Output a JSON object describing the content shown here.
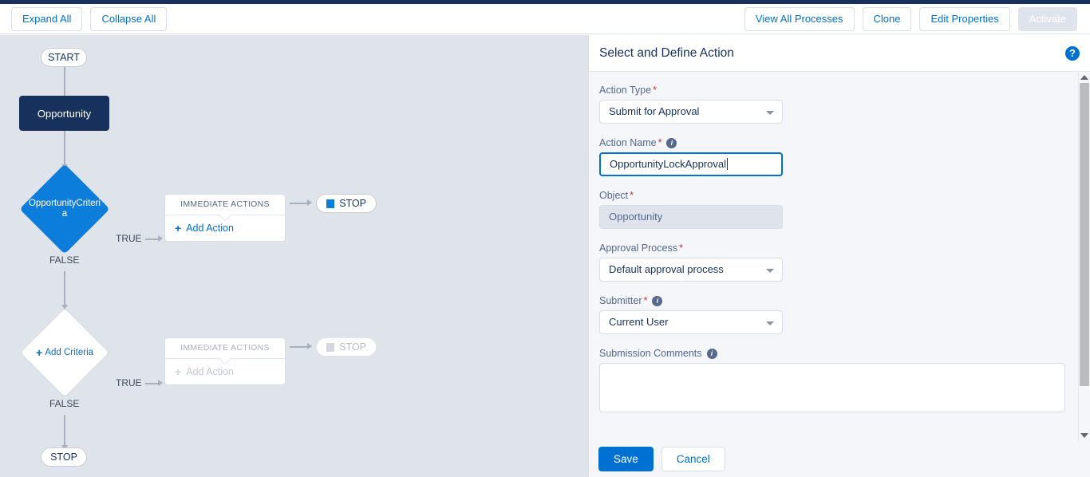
{
  "toolbar": {
    "left_buttons": [
      {
        "label": "Expand All",
        "name": "expand-all-button"
      },
      {
        "label": "Collapse All",
        "name": "collapse-all-button"
      }
    ],
    "right_buttons": [
      {
        "label": "View All Processes",
        "name": "view-all-processes-button"
      },
      {
        "label": "Clone",
        "name": "clone-button"
      },
      {
        "label": "Edit Properties",
        "name": "edit-properties-button"
      },
      {
        "label": "Activate",
        "name": "activate-button",
        "disabled": true
      }
    ]
  },
  "flow": {
    "start_label": "START",
    "object_node_label": "Opportunity",
    "criteria_1": {
      "label": "OpportunityCriteria",
      "true_label": "TRUE",
      "false_label": "FALSE"
    },
    "actions_1": {
      "header": "IMMEDIATE ACTIONS",
      "add_action_label": "Add Action",
      "plus": "+"
    },
    "stop_1_label": "STOP",
    "criteria_2": {
      "label": "Add Criteria",
      "plus": "+",
      "true_label": "TRUE",
      "false_label": "FALSE"
    },
    "actions_2": {
      "header": "IMMEDIATE ACTIONS",
      "add_action_label": "Add Action",
      "plus": "+"
    },
    "stop_2_label": "STOP",
    "stop_final_label": "STOP"
  },
  "panel": {
    "title": "Select and Define Action",
    "help_icon_glyph": "?",
    "info_icon_glyph": "i",
    "fields": {
      "action_type": {
        "label": "Action Type",
        "required": "*",
        "value": "Submit for Approval"
      },
      "action_name": {
        "label": "Action Name",
        "required": "*",
        "value": "OpportunityLockApproval",
        "focused": true
      },
      "object": {
        "label": "Object",
        "required": "*",
        "value": "Opportunity",
        "readonly": true
      },
      "approval_process": {
        "label": "Approval Process",
        "required": "*",
        "value": "Default approval process"
      },
      "submitter": {
        "label": "Submitter",
        "required": "*",
        "value": "Current User"
      },
      "submission_comments": {
        "label": "Submission Comments",
        "value": ""
      }
    },
    "footer": {
      "save_label": "Save",
      "cancel_label": "Cancel"
    }
  },
  "colors": {
    "brand_blue": "#0070d2",
    "dark_navy": "#16325c",
    "canvas_bg": "#dfe3ea",
    "panel_bg": "#f4f6f9",
    "required_red": "#c23934"
  }
}
